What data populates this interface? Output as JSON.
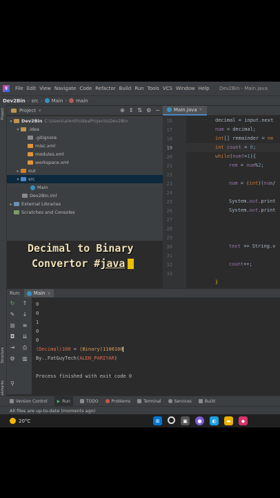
{
  "ide": {
    "menu": [
      "File",
      "Edit",
      "View",
      "Navigate",
      "Code",
      "Refactor",
      "Build",
      "Run",
      "Tools",
      "VCS",
      "Window",
      "Help"
    ],
    "window_title": "Dev2Bin - Main.java",
    "breadcrumb": [
      "Dev2Bin",
      "src",
      "Main",
      "main"
    ]
  },
  "project": {
    "header_label": "Project",
    "tree": [
      {
        "label": "Dev2Bin",
        "path": "C:\\Users\\alenth\\IdeaProjects\\Dev2Bin"
      },
      {
        "label": ".idea"
      },
      {
        "label": ".gitignore"
      },
      {
        "label": "misc.xml"
      },
      {
        "label": "modules.xml"
      },
      {
        "label": "workspace.xml"
      },
      {
        "label": "out"
      },
      {
        "label": "src"
      },
      {
        "label": "Main"
      },
      {
        "label": "Dev2Bin.iml"
      },
      {
        "label": "External Libraries"
      },
      {
        "label": "Scratches and Consoles"
      }
    ]
  },
  "overlay": {
    "line1": "Decimal to Binary",
    "line2_prefix": "Convertor #",
    "line2_link": "java"
  },
  "editor": {
    "tab": "Main.java",
    "line_numbers": [
      "16",
      "17",
      "18",
      "19",
      "20",
      "21",
      "22",
      "23",
      "24",
      "25",
      "26",
      "27",
      "28",
      "29",
      "30",
      "31",
      "32",
      "33"
    ],
    "current_line": "19"
  },
  "run": {
    "label": "Run:",
    "tab": "Main",
    "output": {
      "bits": [
        "0",
        "0",
        "1",
        "0",
        "0"
      ],
      "result_label_dec": "(Decimal)",
      "result_dec": "100",
      "result_eq": " = ",
      "result_label_bin": "(Binary)",
      "result_bin": "1100100",
      "credit_prefix": "By..FatGuyTech(",
      "credit_name": "ALEN_PARIYAR",
      "credit_suffix": ")",
      "finished": "Process finished with exit code 0"
    }
  },
  "tool_tabs": [
    "Version Control",
    "Run",
    "TODO",
    "Problems",
    "Terminal",
    "Services",
    "Build"
  ],
  "status": "All files are up-to-date (moments ago)",
  "vertical_tabs": {
    "project": "Project",
    "structure": "Structure",
    "bookmarks": "Bookmarks"
  },
  "taskbar": {
    "temperature": "20°C"
  },
  "colors": {
    "keyword": "#cc7832",
    "variable": "#9876aa",
    "number": "#6897bb",
    "selection": "#0d293e",
    "overlay_text": "#f0e2b6",
    "cursor": "#e8c000"
  }
}
